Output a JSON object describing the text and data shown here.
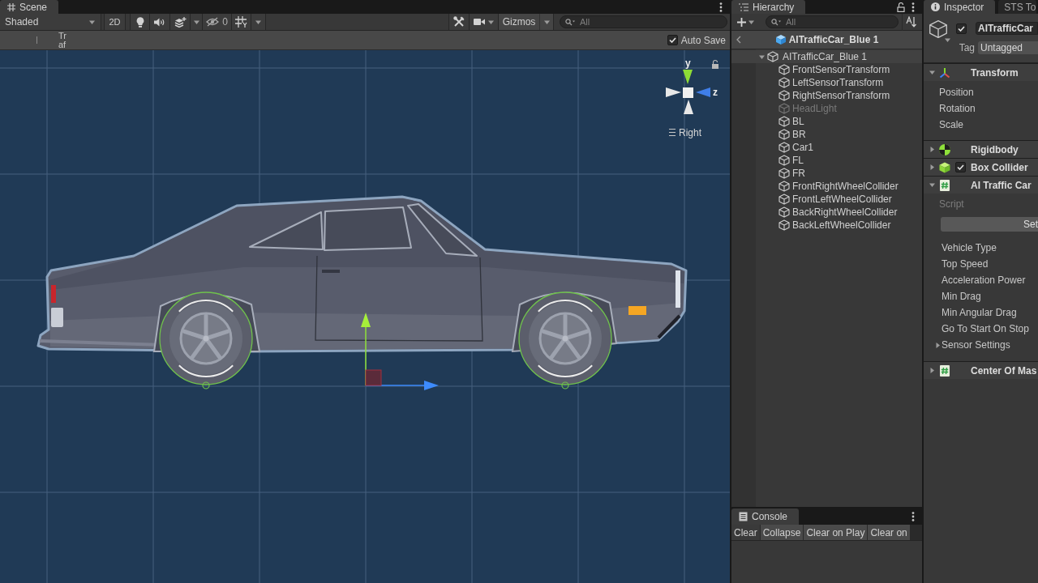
{
  "scene": {
    "tab": {
      "label": "Scene",
      "selected": true
    },
    "toolbar": {
      "shading": "Shaded",
      "view_2d": "2D",
      "hidden_count": "0",
      "gizmos": "Gizmos",
      "search": {
        "placeholder": "All"
      }
    },
    "overlay": {
      "text_1": "Tr",
      "text_2": "af",
      "auto_save": {
        "label": "Auto Save",
        "checked": true
      }
    },
    "viewport": {
      "axis_y": "y",
      "axis_z": "z",
      "view": "Right"
    }
  },
  "hierarchy": {
    "tab": {
      "label": "Hierarchy",
      "selected": true
    },
    "search": {
      "placeholder": "All"
    },
    "breadcrumb": "AITrafficCar_Blue 1",
    "tree": [
      {
        "label": "AITrafficCar_Blue 1",
        "expanded": true,
        "disabled": false,
        "children": [
          {
            "label": "FrontSensorTransform",
            "disabled": false
          },
          {
            "label": "LeftSensorTransform",
            "disabled": false
          },
          {
            "label": "RightSensorTransform",
            "disabled": false
          },
          {
            "label": "HeadLight",
            "disabled": true
          },
          {
            "label": "BL",
            "disabled": false
          },
          {
            "label": "BR",
            "disabled": false
          },
          {
            "label": "Car1",
            "disabled": false
          },
          {
            "label": "FL",
            "disabled": false
          },
          {
            "label": "FR",
            "disabled": false
          },
          {
            "label": "FrontRightWheelCollider",
            "disabled": false
          },
          {
            "label": "FrontLeftWheelCollider",
            "disabled": false
          },
          {
            "label": "BackRightWheelCollider",
            "disabled": false
          },
          {
            "label": "BackLeftWheelCollider",
            "disabled": false
          }
        ]
      }
    ]
  },
  "console": {
    "tab": {
      "label": "Console",
      "selected": true
    },
    "buttons": [
      {
        "label": "Clear",
        "kind": "button"
      },
      {
        "label": "Collapse",
        "kind": "toggle"
      },
      {
        "label": "Clear on Play",
        "kind": "toggle"
      },
      {
        "label": "Clear on",
        "kind": "toggle"
      }
    ]
  },
  "inspector": {
    "tabs": [
      {
        "label": "Inspector",
        "selected": true
      },
      {
        "label": "STS To",
        "selected": false
      }
    ],
    "object": {
      "active": true,
      "name": "AITrafficCar",
      "tag_label": "Tag",
      "tag": "Untagged"
    },
    "components": [
      {
        "kind": "transform",
        "name": "Transform",
        "expanded": true,
        "fields": [
          {
            "label": "Position"
          },
          {
            "label": "Rotation"
          },
          {
            "label": "Scale"
          }
        ]
      },
      {
        "kind": "rigidbody",
        "name": "Rigidbody",
        "expanded": false
      },
      {
        "kind": "collider",
        "name": "Box Collider",
        "expanded": false,
        "enabled": true
      },
      {
        "kind": "script",
        "name": "AI Traffic Car",
        "expanded": true,
        "script_label": "Script",
        "button": "Set",
        "fields": [
          {
            "label": "Vehicle Type",
            "kind": "field"
          },
          {
            "label": "Top Speed",
            "kind": "field"
          },
          {
            "label": "Acceleration Power",
            "kind": "field"
          },
          {
            "label": "Min Drag",
            "kind": "field"
          },
          {
            "label": "Min Angular Drag",
            "kind": "field"
          },
          {
            "label": "Go To Start On Stop",
            "kind": "field"
          },
          {
            "label": "Sensor Settings",
            "kind": "foldout",
            "expanded": false
          }
        ]
      },
      {
        "kind": "script",
        "name": "Center Of Mas",
        "expanded": false
      }
    ]
  }
}
